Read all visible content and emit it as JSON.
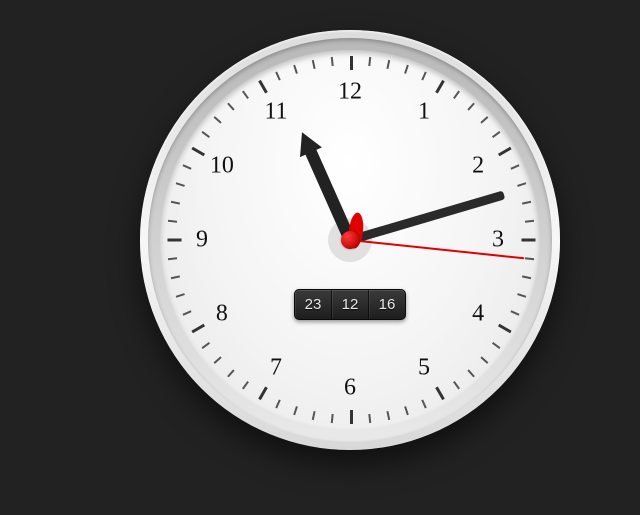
{
  "clock": {
    "numerals": [
      "12",
      "1",
      "2",
      "3",
      "4",
      "5",
      "6",
      "7",
      "8",
      "9",
      "10",
      "11"
    ],
    "time": {
      "hours": 11,
      "minutes": 12,
      "seconds": 16
    },
    "digital": {
      "hh": "23",
      "mm": "12",
      "ss": "16"
    },
    "colors": {
      "second_hand": "#e10000",
      "hands": "#222222",
      "face": "#f4f4f4"
    }
  }
}
